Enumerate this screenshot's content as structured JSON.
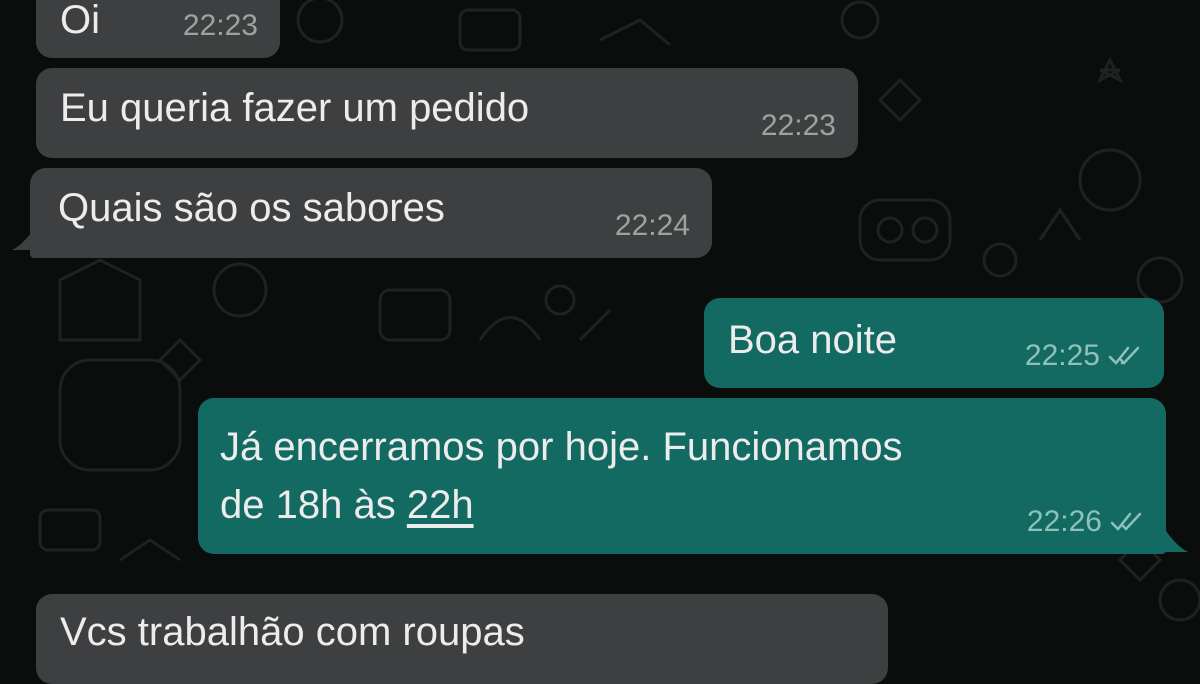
{
  "messages": [
    {
      "text": "Oi",
      "time": "22:23"
    },
    {
      "text": "Eu queria fazer um pedido",
      "time": "22:23"
    },
    {
      "text": "Quais são os sabores",
      "time": "22:24"
    },
    {
      "text": "Boa noite",
      "time": "22:25"
    },
    {
      "line1": "Já encerramos por hoje. Funcionamos",
      "line2_prefix": "de 18h às ",
      "line2_link": "22h",
      "time": "22:26"
    },
    {
      "text": "Vcs trabalhão com roupas"
    }
  ],
  "colors": {
    "background": "#0b0d0c",
    "incoming_bubble": "#3d3f40",
    "outgoing_bubble": "#136a62",
    "text": "#ececec"
  },
  "icons": {
    "read_receipt": "double-check-icon"
  }
}
